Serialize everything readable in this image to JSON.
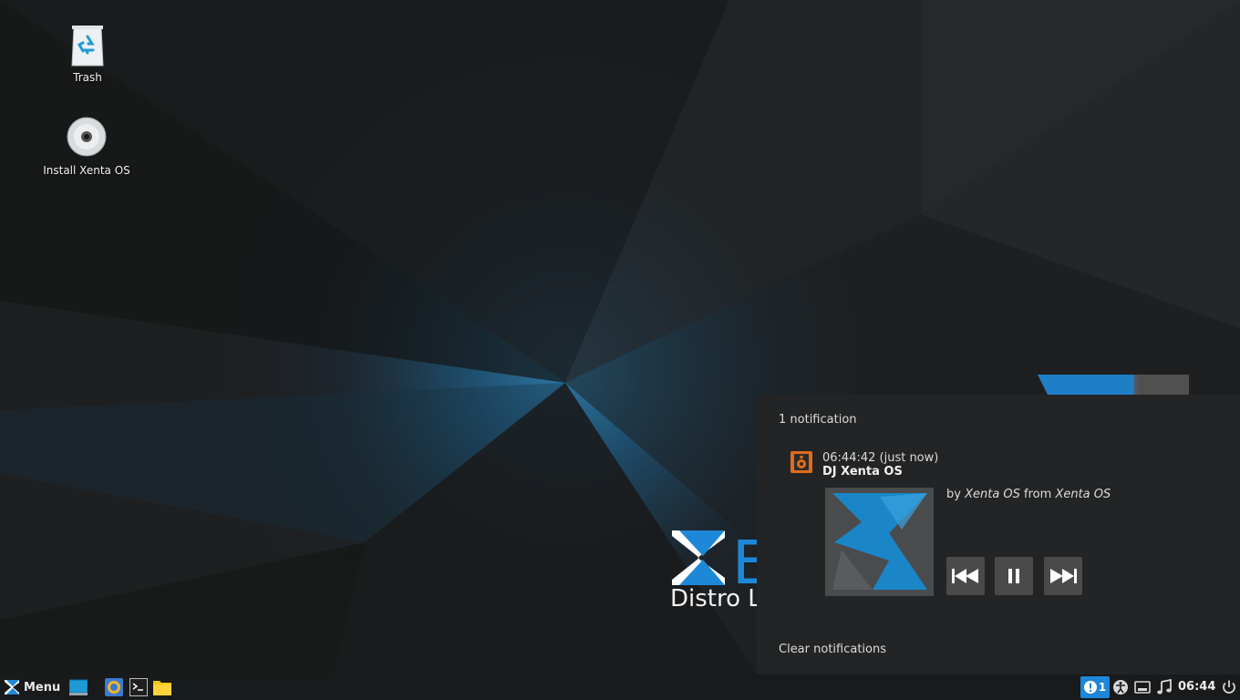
{
  "desktop": {
    "icons": [
      {
        "label": "Trash",
        "icon": "trash-icon"
      },
      {
        "label": "Install Xenta OS",
        "icon": "install-disc-icon"
      }
    ],
    "logo": {
      "letters": "E",
      "tagline": "Distro Linux Indonesia"
    }
  },
  "notifications": {
    "count_text": "1 notification",
    "items": [
      {
        "app_icon": "speaker-icon",
        "time": "06:44:42 (just now)",
        "title": "DJ Xenta OS",
        "body_prefix": "by ",
        "artist": "Xenta OS",
        "body_middle": " from ",
        "album": "Xenta OS",
        "controls": [
          "previous-icon",
          "pause-icon",
          "next-icon"
        ]
      }
    ],
    "clear_label": "Clear notifications"
  },
  "taskbar": {
    "menu_label": "Menu",
    "launchers": [
      "show-desktop-icon",
      "web-browser-icon",
      "terminal-icon",
      "file-manager-icon"
    ],
    "tray": {
      "notification_count": "1",
      "icons": [
        "accessibility-icon",
        "network-icon",
        "music-icon",
        "power-icon"
      ]
    },
    "clock": "06:44"
  },
  "colors": {
    "accent": "#1e88d8",
    "panel": "#232425",
    "taskbar": "#191a1b"
  }
}
